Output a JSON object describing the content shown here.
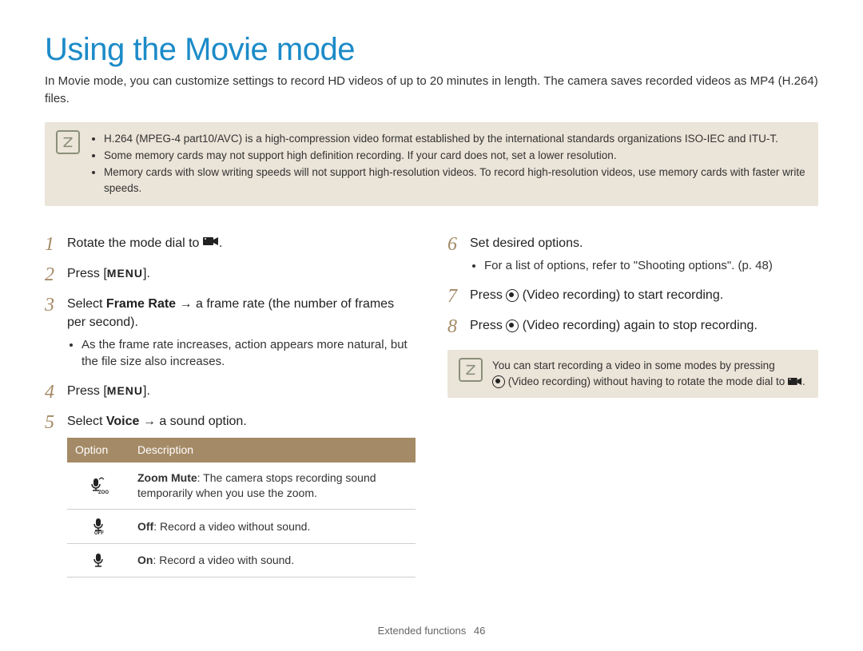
{
  "title": "Using the Movie mode",
  "intro": "In Movie mode, you can customize settings to record HD videos of up to 20 minutes in length. The camera saves recorded videos as MP4 (H.264) files.",
  "note1": {
    "items": [
      "H.264 (MPEG-4 part10/AVC) is a high-compression video format established by the international standards organizations ISO-IEC and ITU-T.",
      "Some memory cards may not support high definition recording. If your card does not, set a lower resolution.",
      "Memory cards with slow writing speeds will not support high-resolution videos. To record high-resolution videos, use memory cards with faster write speeds."
    ]
  },
  "left": {
    "s1": {
      "num": "1",
      "pre": "Rotate the mode dial to ",
      "post": "."
    },
    "s2": {
      "num": "2",
      "pre": "Press [",
      "menu": "MENU",
      "post": "]."
    },
    "s3": {
      "num": "3",
      "a": "Select ",
      "b": "Frame Rate",
      "c": " → a frame rate (the number of frames per second).",
      "sub": "As the frame rate increases, action appears more natural, but the file size also increases."
    },
    "s4": {
      "num": "4",
      "pre": "Press [",
      "menu": "MENU",
      "post": "]."
    },
    "s5": {
      "num": "5",
      "a": "Select ",
      "b": "Voice",
      "c": " → a sound option."
    },
    "table": {
      "h1": "Option",
      "h2": "Description",
      "rows": [
        {
          "desc_b": "Zoom Mute",
          "desc": ": The camera stops recording sound temporarily when you use the zoom."
        },
        {
          "desc_b": "Off",
          "desc": ": Record a video without sound."
        },
        {
          "desc_b": "On",
          "desc": ": Record a video with sound."
        }
      ]
    }
  },
  "right": {
    "s6": {
      "num": "6",
      "text": "Set desired options.",
      "sub": "For a list of options, refer to \"Shooting options\". (p. 48)"
    },
    "s7": {
      "num": "7",
      "pre": "Press ",
      "post": " (Video recording) to start recording."
    },
    "s8": {
      "num": "8",
      "pre": "Press ",
      "post": " (Video recording) again to stop recording."
    },
    "note2": {
      "line1": "You can start recording a video in some modes by pressing",
      "line2a": " (Video recording) without having to rotate the mode dial to ",
      "line2b": "."
    }
  },
  "footer": {
    "section": "Extended functions",
    "page": "46"
  }
}
